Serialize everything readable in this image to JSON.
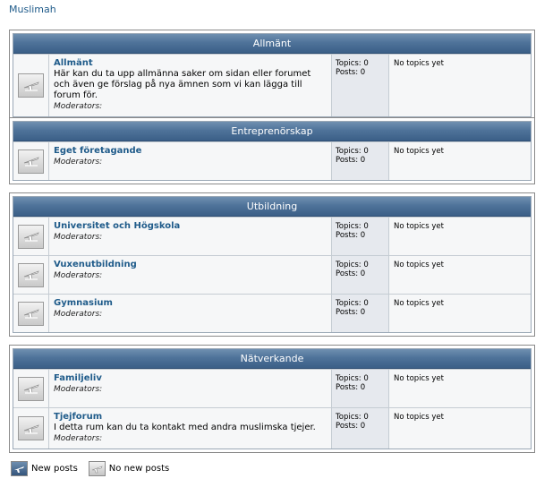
{
  "breadcrumb": "Muslimah",
  "stats": {
    "topics_label": "Topics:",
    "posts_label": "Posts:"
  },
  "last_post_empty": "No topics yet",
  "moderators_label": "Moderators:",
  "categories": [
    {
      "title": "Allmänt",
      "forums": [
        {
          "name": "Allmänt",
          "description": "Här kan du ta upp allmänna saker om sidan eller forumet och även ge förslag på nya ämnen som vi kan lägga till forum för.",
          "topics": "0",
          "posts": "0"
        }
      ]
    },
    {
      "title": "Entreprenörskap",
      "forums": [
        {
          "name": "Eget företagande",
          "description": "",
          "topics": "0",
          "posts": "0"
        }
      ]
    },
    {
      "title": "Utbildning",
      "forums": [
        {
          "name": "Universitet och Högskola",
          "description": "",
          "topics": "0",
          "posts": "0"
        },
        {
          "name": "Vuxenutbildning",
          "description": "",
          "topics": "0",
          "posts": "0"
        },
        {
          "name": "Gymnasium",
          "description": "",
          "topics": "0",
          "posts": "0"
        }
      ]
    },
    {
      "title": "Nätverkande",
      "forums": [
        {
          "name": "Familjeliv",
          "description": "",
          "topics": "0",
          "posts": "0"
        },
        {
          "name": "Tjejforum",
          "description": "I detta rum kan du ta kontakt med andra muslimska tjejer.",
          "topics": "0",
          "posts": "0"
        }
      ]
    }
  ],
  "legend": {
    "new_posts": "New posts",
    "no_new_posts": "No new posts"
  }
}
